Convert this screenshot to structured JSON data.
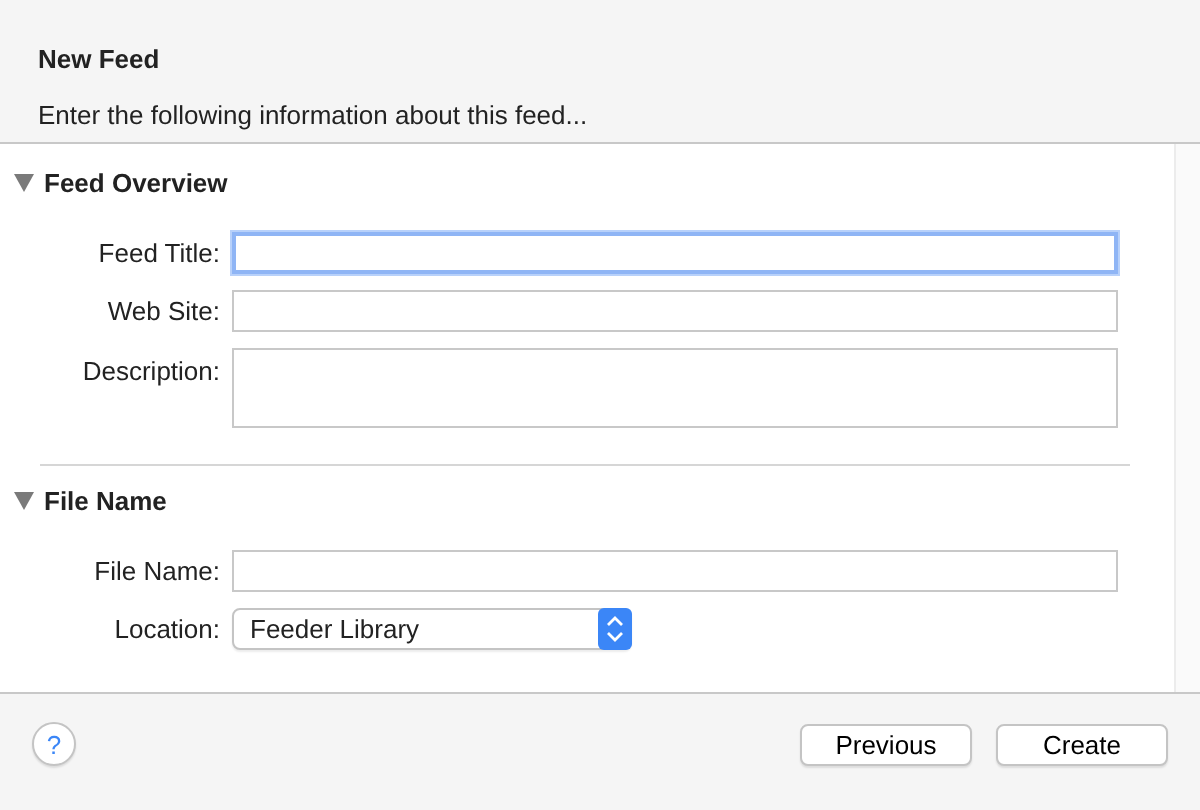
{
  "dialog": {
    "title": "New Feed",
    "subtitle": "Enter the following information about this feed..."
  },
  "sections": [
    {
      "title": "Feed Overview",
      "expanded": true,
      "fields": [
        {
          "kind": "text",
          "label": "Feed Title:",
          "focused": true
        },
        {
          "kind": "text",
          "label": "Web Site:",
          "focused": false
        },
        {
          "kind": "textarea",
          "label": "Description:",
          "focused": false
        }
      ]
    },
    {
      "title": "File Name",
      "expanded": true,
      "fields": [
        {
          "kind": "text",
          "label": "File Name:",
          "focused": false
        },
        {
          "kind": "popup",
          "label": "Location:",
          "value": "Feeder Library"
        }
      ]
    }
  ],
  "footer": {
    "help": "?",
    "buttons": [
      "Previous",
      "Create"
    ]
  }
}
